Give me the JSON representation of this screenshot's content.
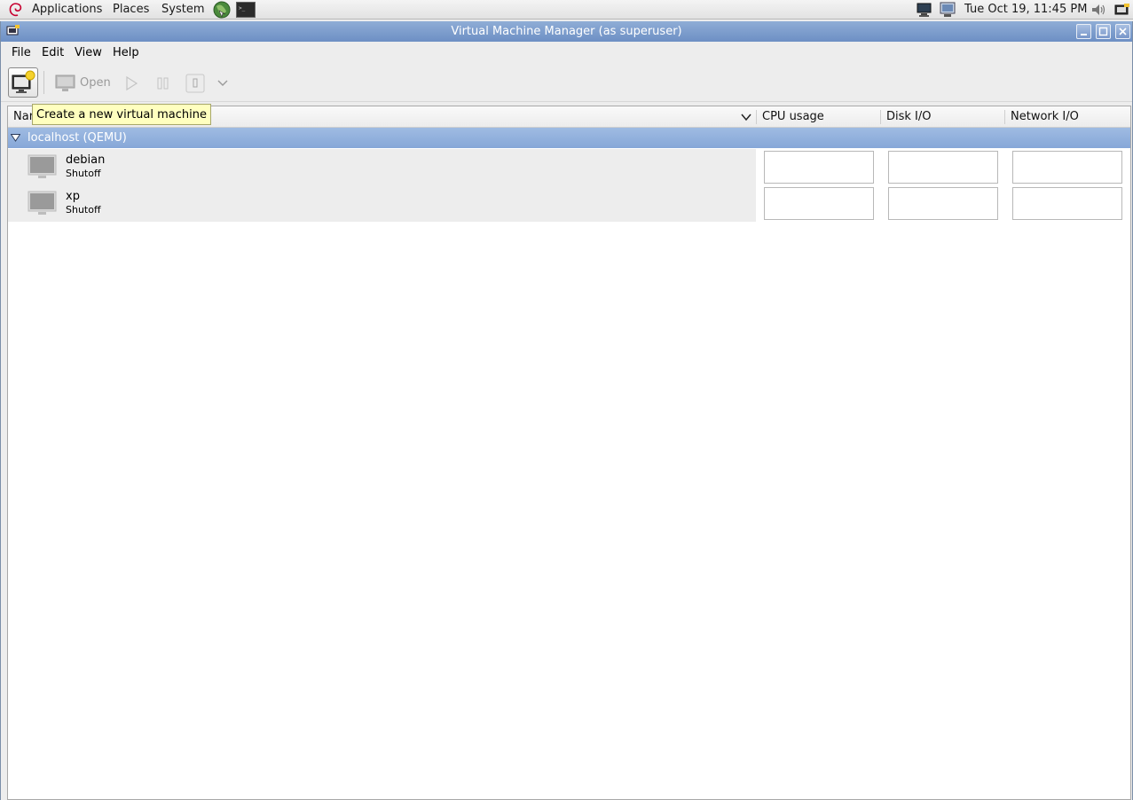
{
  "panel": {
    "menus": [
      "Applications",
      "Places",
      "System"
    ],
    "clock": "Tue Oct 19, 11:45 PM"
  },
  "window": {
    "title": "Virtual Machine Manager (as superuser)"
  },
  "menubar": [
    "File",
    "Edit",
    "View",
    "Help"
  ],
  "toolbar": {
    "open_label": "Open"
  },
  "tooltip": "Create a new virtual machine",
  "table": {
    "columns": [
      "Nar",
      "CPU usage",
      "Disk I/O",
      "Network I/O"
    ],
    "group": "localhost (QEMU)",
    "vms": [
      {
        "name": "debian",
        "status": "Shutoff"
      },
      {
        "name": "xp",
        "status": "Shutoff"
      }
    ]
  },
  "colors": {
    "titlebar": "#7a9ace",
    "selection": "#93b2df",
    "tooltip_bg": "#ffffbf"
  },
  "icons": [
    "debian-swirl-icon",
    "web-browser-icon",
    "terminal-icon",
    "network-icon",
    "display-icon",
    "volume-icon",
    "virt-manager-icon"
  ]
}
